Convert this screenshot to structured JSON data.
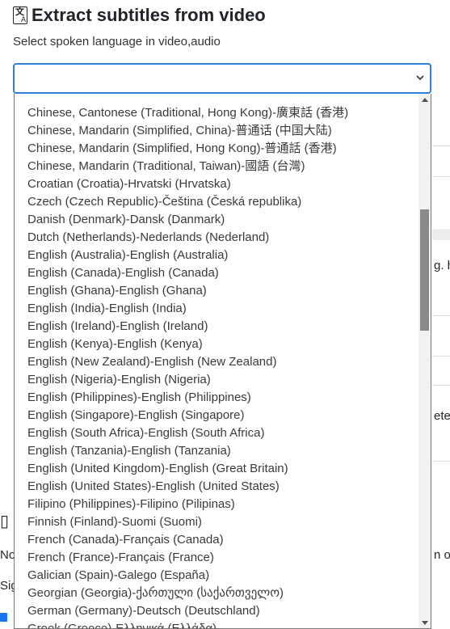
{
  "header": {
    "title": "Extract subtitles from video",
    "icon": "translate-document-icon"
  },
  "subtitle": "Select spoken language in video,audio",
  "language_select": {
    "value": "",
    "icon": "chevron-down-icon",
    "options": [
      "Chinese, Cantonese (Traditional, Hong Kong)-廣東話 (香港)",
      "Chinese, Mandarin (Simplified, China)-普通话 (中国大陆)",
      "Chinese, Mandarin (Simplified, Hong Kong)-普通話 (香港)",
      "Chinese, Mandarin (Traditional, Taiwan)-國語 (台灣)",
      "Croatian (Croatia)-Hrvatski (Hrvatska)",
      "Czech (Czech Republic)-Čeština (Česká republika)",
      "Danish (Denmark)-Dansk (Danmark)",
      "Dutch (Netherlands)-Nederlands (Nederland)",
      "English (Australia)-English (Australia)",
      "English (Canada)-English (Canada)",
      "English (Ghana)-English (Ghana)",
      "English (India)-English (India)",
      "English (Ireland)-English (Ireland)",
      "English (Kenya)-English (Kenya)",
      "English (New Zealand)-English (New Zealand)",
      "English (Nigeria)-English (Nigeria)",
      "English (Philippines)-English (Philippines)",
      "English (Singapore)-English (Singapore)",
      "English (South Africa)-English (South Africa)",
      "English (Tanzania)-English (Tanzania)",
      "English (United Kingdom)-English (Great Britain)",
      "English (United States)-English (United States)",
      "Filipino (Philippines)-Filipino (Pilipinas)",
      "Finnish (Finland)-Suomi (Suomi)",
      "French (Canada)-Français (Canada)",
      "French (France)-Français (France)",
      "Galician (Spain)-Galego (España)",
      "Georgian (Georgia)-ქართული (საქართველო)",
      "German (Germany)-Deutsch (Deutschland)",
      "Greek (Greece)-Ελληνικά (Ελλάδα)"
    ]
  },
  "background_fragments": {
    "right_1": "g. h",
    "right_2": "ete",
    "right_3": "n or",
    "left_1": "Nov",
    "left_2": "Sig",
    "left_3": "F"
  },
  "colors": {
    "focus_border": "#2f7fd4",
    "checkbox": "#1a73e8"
  }
}
